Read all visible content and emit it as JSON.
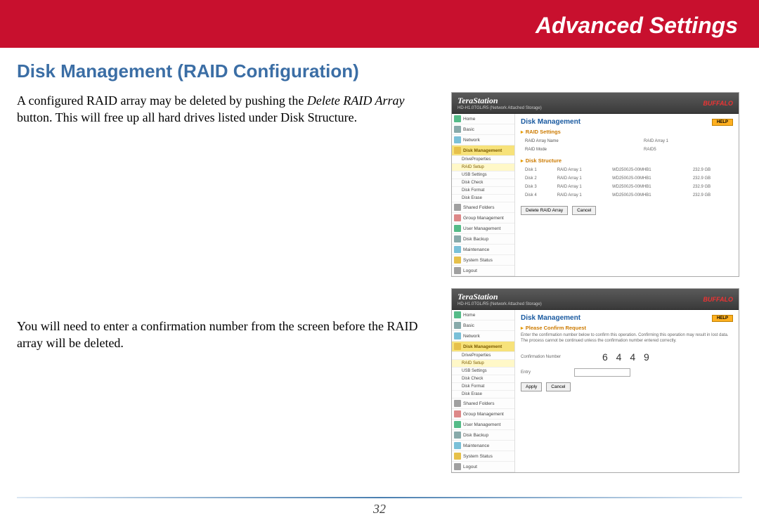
{
  "header": {
    "title": "Advanced Settings"
  },
  "section": {
    "title": "Disk Management (RAID Configuration)"
  },
  "paragraph1": {
    "pre": "A configured RAID array may be deleted by pushing the ",
    "em": "Delete RAID Array",
    "post": " button.  This will free up all hard drives listed under Disk Structure."
  },
  "paragraph2": "You will need to enter a confirmation number from the screen before the RAID array will be deleted.",
  "pageNumber": "32",
  "screenshot1": {
    "brand": "TeraStation",
    "subbrand": "HD-H1.0TGL/R5 (Network Attached Storage)",
    "buffalo": "BUFFALO",
    "help": "HELP",
    "mainTitle": "Disk Management",
    "sidebar": [
      {
        "label": "Home",
        "type": "top"
      },
      {
        "label": "Basic",
        "type": "top"
      },
      {
        "label": "Network",
        "type": "top"
      },
      {
        "label": "Disk Management",
        "type": "active"
      },
      {
        "label": "DriveProperties",
        "type": "sub"
      },
      {
        "label": "RAID Setup",
        "type": "highlight"
      },
      {
        "label": "USB Settings",
        "type": "sub"
      },
      {
        "label": "Disk Check",
        "type": "sub"
      },
      {
        "label": "Disk Format",
        "type": "sub"
      },
      {
        "label": "Disk Erase",
        "type": "sub"
      },
      {
        "label": "Shared Folders",
        "type": "top"
      },
      {
        "label": "Group Management",
        "type": "top"
      },
      {
        "label": "User Management",
        "type": "top"
      },
      {
        "label": "Disk Backup",
        "type": "top"
      },
      {
        "label": "Maintenance",
        "type": "top"
      },
      {
        "label": "System Status",
        "type": "top"
      },
      {
        "label": "Logout",
        "type": "top"
      }
    ],
    "raidSettingsTitle": "RAID Settings",
    "raidSettings": [
      {
        "label": "RAID Array Name",
        "value": "RAID Array 1"
      },
      {
        "label": "RAID Mode",
        "value": "RAID5"
      }
    ],
    "diskStructureTitle": "Disk Structure",
    "disks": [
      {
        "d": "Disk 1",
        "a": "RAID Array 1",
        "m": "WD2500JS-00MHB1",
        "s": "232.9 GB"
      },
      {
        "d": "Disk 2",
        "a": "RAID Array 1",
        "m": "WD2500JS-00MHB1",
        "s": "232.9 GB"
      },
      {
        "d": "Disk 3",
        "a": "RAID Array 1",
        "m": "WD2500JS-00MHB1",
        "s": "232.9 GB"
      },
      {
        "d": "Disk 4",
        "a": "RAID Array 1",
        "m": "WD2500JS-00MHB1",
        "s": "232.9 GB"
      }
    ],
    "buttons": {
      "delete": "Delete RAID Array",
      "cancel": "Cancel"
    }
  },
  "screenshot2": {
    "brand": "TeraStation",
    "subbrand": "HD-H1.0TGL/R5 (Network Attached Storage)",
    "buffalo": "BUFFALO",
    "help": "HELP",
    "mainTitle": "Disk Management",
    "confirmTitle": "Please Confirm Request",
    "confirmText": "Enter the confirmation number below to confirm this operation. Confirming this operation may result in lost data. The process cannot be continued unless the confirmation number entered correctly.",
    "confNumberLabel": "Confirmation Number",
    "confNumber": "6 4 4 9",
    "entryLabel": "Entry",
    "buttons": {
      "apply": "Apply",
      "cancel": "Cancel"
    },
    "sidebar": [
      {
        "label": "Home",
        "type": "top"
      },
      {
        "label": "Basic",
        "type": "top"
      },
      {
        "label": "Network",
        "type": "top"
      },
      {
        "label": "Disk Management",
        "type": "active"
      },
      {
        "label": "DriveProperties",
        "type": "sub"
      },
      {
        "label": "RAID Setup",
        "type": "highlight"
      },
      {
        "label": "USB Settings",
        "type": "sub"
      },
      {
        "label": "Disk Check",
        "type": "sub"
      },
      {
        "label": "Disk Format",
        "type": "sub"
      },
      {
        "label": "Disk Erase",
        "type": "sub"
      },
      {
        "label": "Shared Folders",
        "type": "top"
      },
      {
        "label": "Group Management",
        "type": "top"
      },
      {
        "label": "User Management",
        "type": "top"
      },
      {
        "label": "Disk Backup",
        "type": "top"
      },
      {
        "label": "Maintenance",
        "type": "top"
      },
      {
        "label": "System Status",
        "type": "top"
      },
      {
        "label": "Logout",
        "type": "top"
      }
    ]
  }
}
